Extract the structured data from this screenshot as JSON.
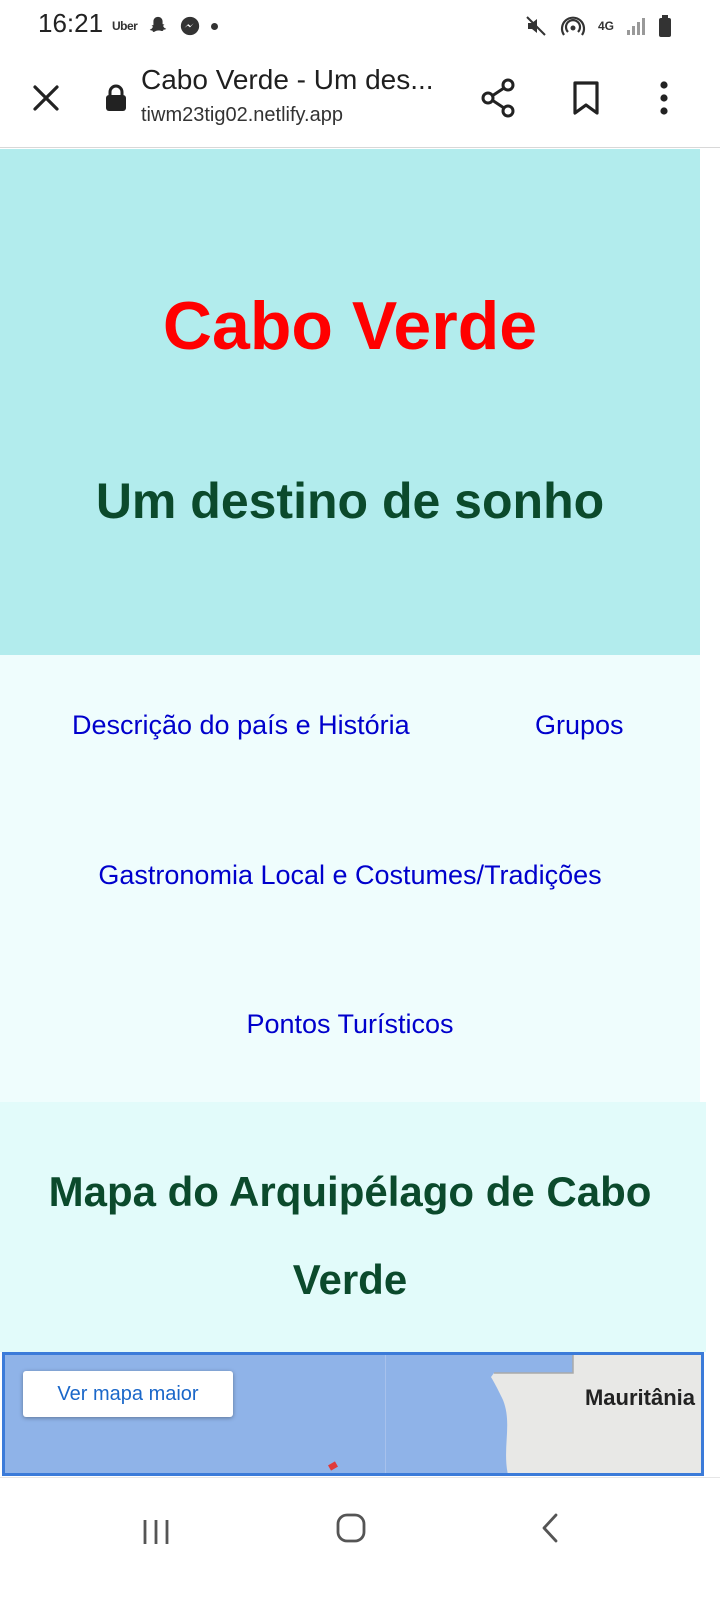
{
  "status_bar": {
    "time": "16:21",
    "app_icons": [
      "uber-icon",
      "snapchat-icon",
      "messenger-icon",
      "dot-icon"
    ],
    "uber_label": "Uber",
    "network_label": "4G",
    "system_icons": [
      "mute-icon",
      "hotspot-icon",
      "network-4g-icon",
      "signal-icon",
      "battery-icon"
    ]
  },
  "browser": {
    "tab_title": "Cabo Verde - Um des...",
    "url": "tiwm23tig02.netlify.app",
    "icons": [
      "close-icon",
      "lock-icon",
      "share-icon",
      "bookmark-icon",
      "more-vert-icon"
    ]
  },
  "hero": {
    "title": "Cabo Verde",
    "subtitle": "Um destino de sonho",
    "colors": {
      "background": "#b2eced",
      "title": "#ff0000",
      "subtitle": "#0b4a2c"
    }
  },
  "nav": {
    "links": [
      {
        "label": "Descrição do país e História"
      },
      {
        "label": "Grupos"
      },
      {
        "label": "Gastronomia Local e Costumes/Tradições"
      },
      {
        "label": "Pontos Turísticos"
      }
    ],
    "colors": {
      "background": "#effdfd",
      "link": "#0000cc"
    }
  },
  "map_section": {
    "heading": "Mapa do Arquipélago de Cabo Verde",
    "view_larger_button": "Ver mapa maior",
    "country_label": "Mauritânia",
    "colors": {
      "background": "#e2fbfa",
      "water": "#8fb3e8",
      "land": "#e8e8e6"
    }
  },
  "system_nav": {
    "icons": [
      "recents-icon",
      "home-icon",
      "back-icon"
    ]
  }
}
